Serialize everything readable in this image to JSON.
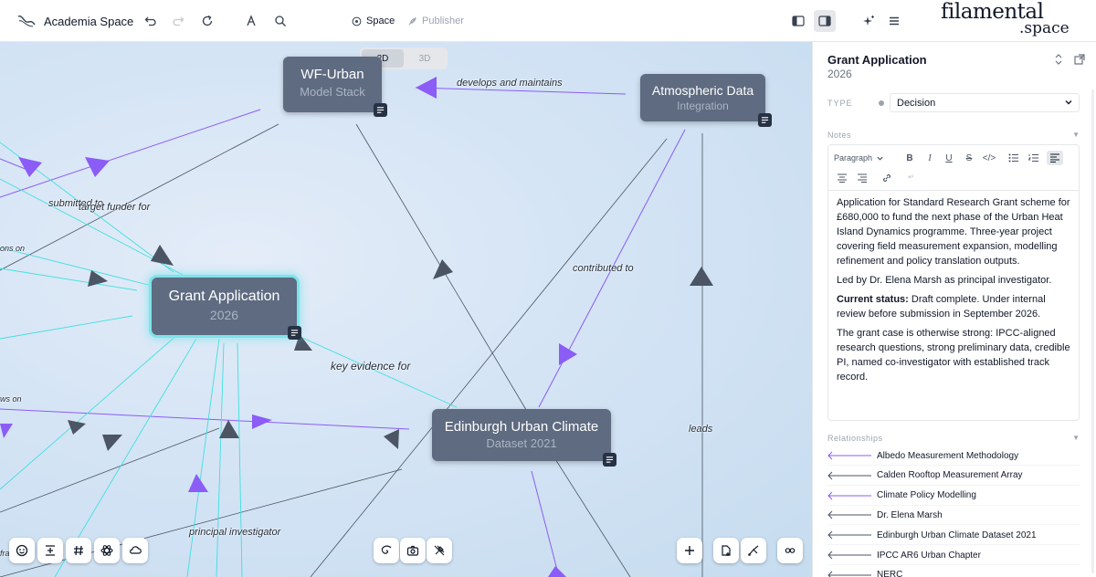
{
  "app": {
    "title": "Academia Space"
  },
  "topbar": {
    "space_label": "Space",
    "publisher_label": "Publisher",
    "brand_line1": "filamental",
    "brand_line2": ".space"
  },
  "canvas": {
    "dim_toggle": [
      "2D",
      "3D"
    ],
    "active_dim": "2D",
    "nodes": [
      {
        "title": "WF-Urban",
        "subtitle": "Model Stack"
      },
      {
        "title": "Atmospheric Data",
        "subtitle": "Integration"
      },
      {
        "title": "Grant Application",
        "subtitle": "2026"
      },
      {
        "title": "Edinburgh Urban Climate",
        "subtitle": "Dataset 2021"
      }
    ],
    "edge_labels": [
      "develops and maintains",
      "submitted to",
      "target funder for",
      "ons on",
      "contributed to",
      "key evidence for",
      "ws on",
      "leads",
      "principal investigator",
      "fra"
    ],
    "colors": {
      "purple": "#8b5cf6",
      "cyan": "#3fe0e0",
      "gray": "#4b5563",
      "node": "#5e6b80",
      "selected_glow": "#7de3ea"
    }
  },
  "panel": {
    "title": "Grant Application",
    "subtitle": "2026",
    "type_label": "TYPE",
    "type_value": "Decision",
    "notes_label": "Notes",
    "paragraph_select": "Paragraph",
    "notes": {
      "p1": "Application for Standard Research Grant scheme for £680,000 to fund the next phase of the Urban Heat Island Dynamics programme. Three-year project covering field measurement expansion, modelling refinement and policy translation outputs.",
      "p2": "Led by Dr. Elena Marsh as principal investigator.",
      "p3_bold": "Current status:",
      "p3_rest": " Draft complete. Under internal review before submission in September 2026.",
      "p4": "The grant case is otherwise strong: IPCC-aligned research questions, strong preliminary data, credible PI, named co-investigator with established track record."
    },
    "relationships_label": "Relationships",
    "relationships": [
      {
        "name": "Albedo Measurement Methodology",
        "color": "#8b5cf6"
      },
      {
        "name": "Calden Rooftop Measurement Array",
        "color": "#4b5563"
      },
      {
        "name": "Climate Policy Modelling",
        "color": "#8b5cf6"
      },
      {
        "name": "Dr. Elena Marsh",
        "color": "#4b5563"
      },
      {
        "name": "Edinburgh Urban Climate Dataset 2021",
        "color": "#4b5563"
      },
      {
        "name": "IPCC AR6 Urban Chapter",
        "color": "#4b5563"
      },
      {
        "name": "NERC",
        "color": "#4b5563"
      }
    ]
  }
}
